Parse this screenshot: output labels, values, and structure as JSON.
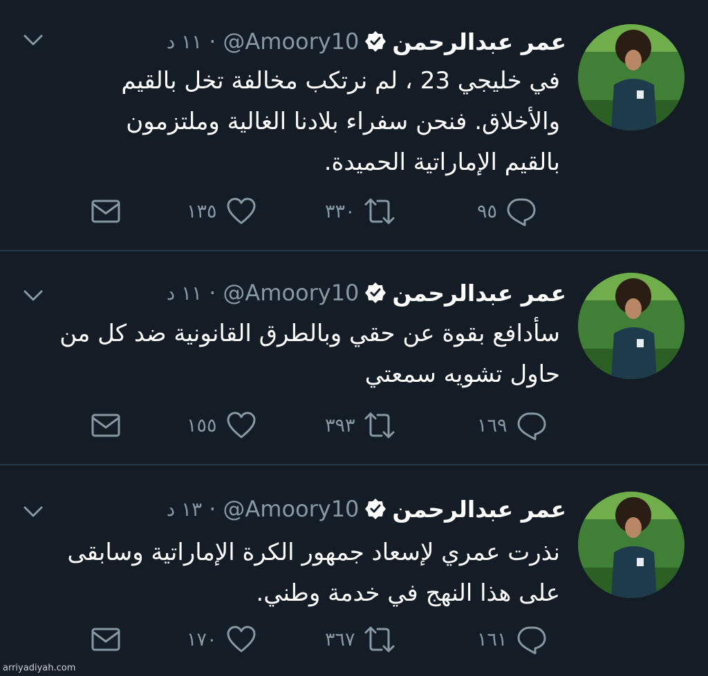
{
  "colors": {
    "background": "#141d26",
    "text": "#ffffff",
    "muted": "#8899a6",
    "separator": "#2b3a4a"
  },
  "tweets": [
    {
      "name": "عمر عبدالرحمن",
      "handle": "@Amoory10",
      "separator": "·",
      "time": "١١ د",
      "lines": [
        "في خليجي 23 ، لم نرتكب مخالفة  تخل بالقيم",
        "والأخلاق.  فنحن سفراء بلادنا الغالية وملتزمون",
        "بالقيم الإماراتية الحميدة."
      ],
      "counts": {
        "reply": "٩٥",
        "retweet": "٣٣٠",
        "like": "١٣٥"
      }
    },
    {
      "name": "عمر عبدالرحمن",
      "handle": "@Amoory10",
      "separator": "·",
      "time": "١١ د",
      "lines": [
        "سأدافع بقوة عن حقي وبالطرق القانونية ضد كل من",
        "حاول تشويه سمعتي"
      ],
      "counts": {
        "reply": "١٦٩",
        "retweet": "٣٩٣",
        "like": "١٥٥"
      }
    },
    {
      "name": "عمر عبدالرحمن",
      "handle": "@Amoory10",
      "separator": "·",
      "time": "١٣ د",
      "lines": [
        "نذرت عمري لإسعاد جمهور الكرة الإماراتية وسابقى",
        "على هذا النهج    في خدمة وطني."
      ],
      "counts": {
        "reply": "١٦١",
        "retweet": "٣٦٧",
        "like": "١٧٠"
      }
    }
  ],
  "icons": {
    "more": "chevron-down-icon",
    "verified": "verified-badge-icon",
    "reply": "reply-bubble-icon",
    "retweet": "retweet-icon",
    "like": "heart-icon",
    "dm": "envelope-icon"
  },
  "watermark": "arriyadiyah.com"
}
